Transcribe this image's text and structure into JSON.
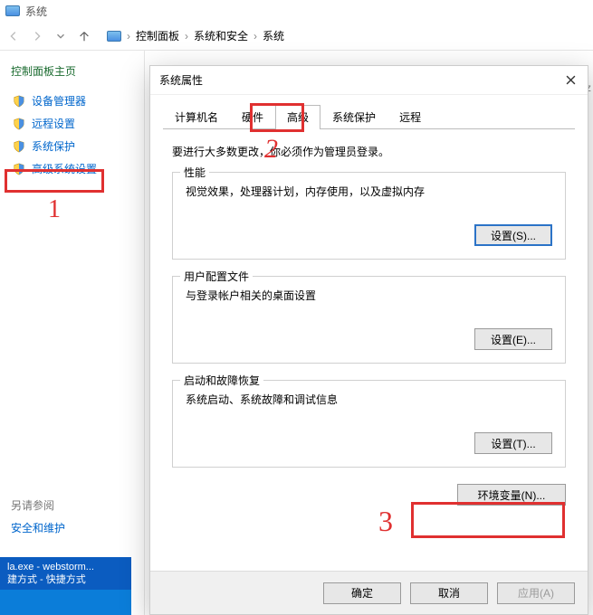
{
  "window": {
    "title": "系统"
  },
  "breadcrumb": {
    "items": [
      "控制面板",
      "系统和安全",
      "系统"
    ]
  },
  "sidebar": {
    "home": "控制面板主页",
    "items": [
      {
        "label": "设备管理器"
      },
      {
        "label": "远程设置"
      },
      {
        "label": "系统保护"
      },
      {
        "label": "高级系统设置"
      }
    ],
    "see_also_header": "另请参阅",
    "see_also_link": "安全和维护"
  },
  "right_truncated": ".z",
  "dialog": {
    "title": "系统属性",
    "tabs": [
      "计算机名",
      "硬件",
      "高级",
      "系统保护",
      "远程"
    ],
    "active_tab_index": 2,
    "admin_note": "要进行大多数更改，你必须作为管理员登录。",
    "groups": {
      "performance": {
        "legend": "性能",
        "desc": "视觉效果，处理器计划，内存使用，以及虚拟内存",
        "button": "设置(S)..."
      },
      "profiles": {
        "legend": "用户配置文件",
        "desc": "与登录帐户相关的桌面设置",
        "button": "设置(E)..."
      },
      "startup": {
        "legend": "启动和故障恢复",
        "desc": "系统启动、系统故障和调试信息",
        "button": "设置(T)..."
      }
    },
    "env_button": "环境变量(N)...",
    "footer": {
      "ok": "确定",
      "cancel": "取消",
      "apply": "应用(A)"
    }
  },
  "annotations": {
    "n1": "1",
    "n2": "2",
    "n3": "3"
  },
  "taskbar": {
    "line1": "la.exe - webstorm...",
    "line2": "建方式    - 快捷方式"
  }
}
